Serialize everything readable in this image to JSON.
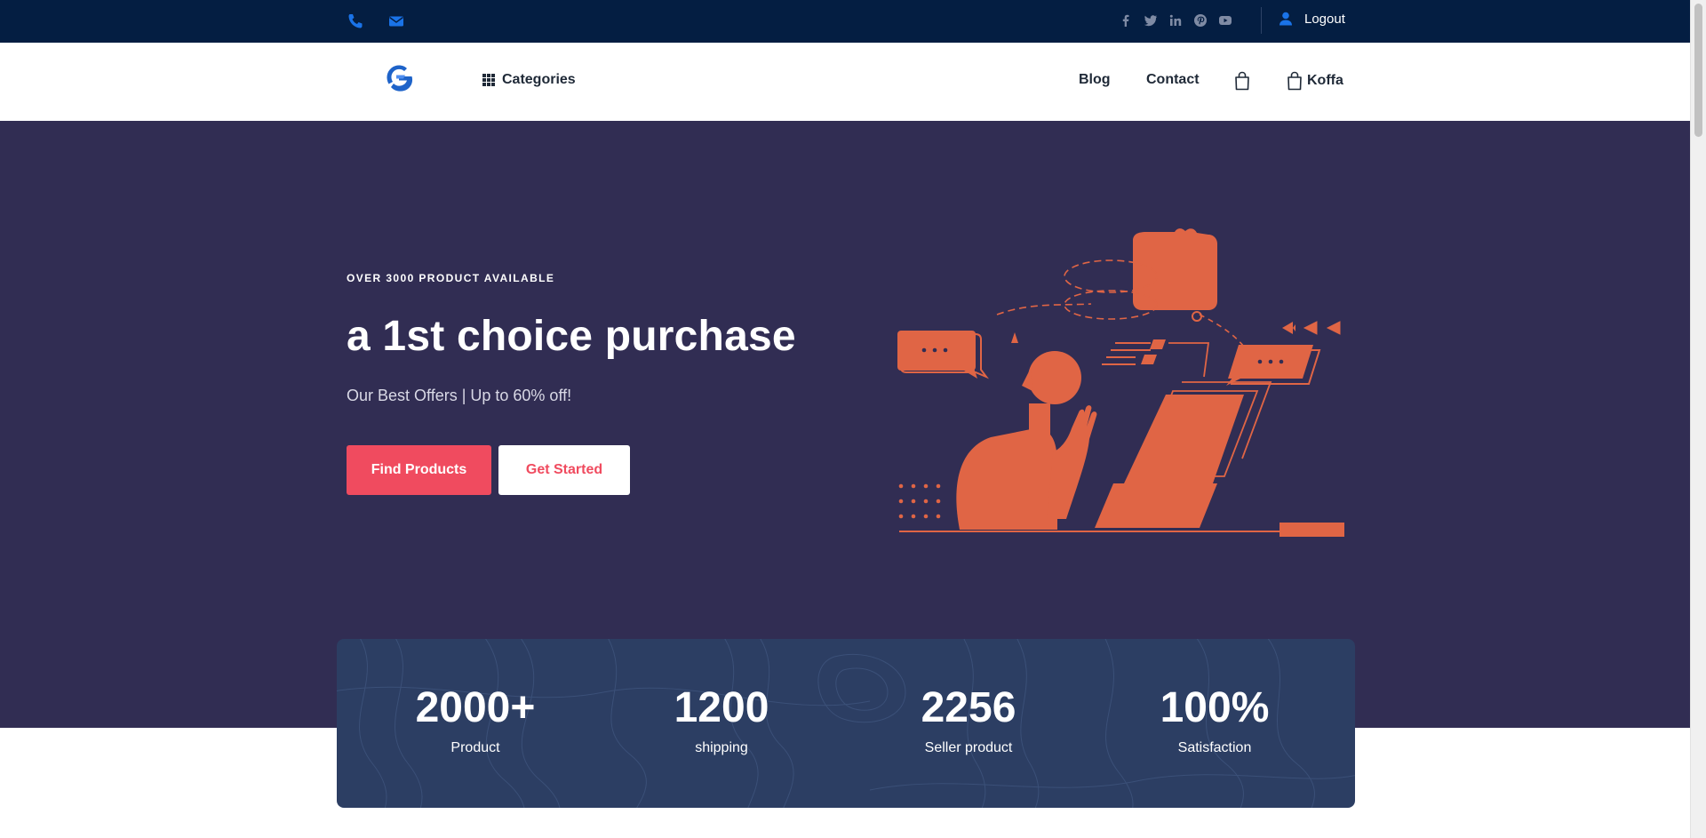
{
  "topbar": {
    "logout_label": "Logout",
    "contact_icons": [
      "phone-icon",
      "envelope-icon"
    ],
    "social_icons": [
      "facebook-icon",
      "twitter-icon",
      "linkedin-icon",
      "pinterest-icon",
      "youtube-icon"
    ],
    "icon_color": "#1a73e8"
  },
  "nav": {
    "categories_label": "Categories",
    "blog_label": "Blog",
    "contact_label": "Contact",
    "user_label": "Koffa"
  },
  "hero": {
    "eyebrow": "OVER 3000 PRODUCT AVAILABLE",
    "headline": "a 1st choice purchase",
    "subtext": "Our Best Offers | Up to 60% off!",
    "primary_button": "Find Products",
    "secondary_button": "Get Started",
    "accent_color": "#f04b5f",
    "illustration_color": "#e06545"
  },
  "stats": [
    {
      "value": "2000+",
      "label": "Product"
    },
    {
      "value": "1200",
      "label": "shipping"
    },
    {
      "value": "2256",
      "label": "Seller product"
    },
    {
      "value": "100%",
      "label": "Satisfaction"
    }
  ]
}
